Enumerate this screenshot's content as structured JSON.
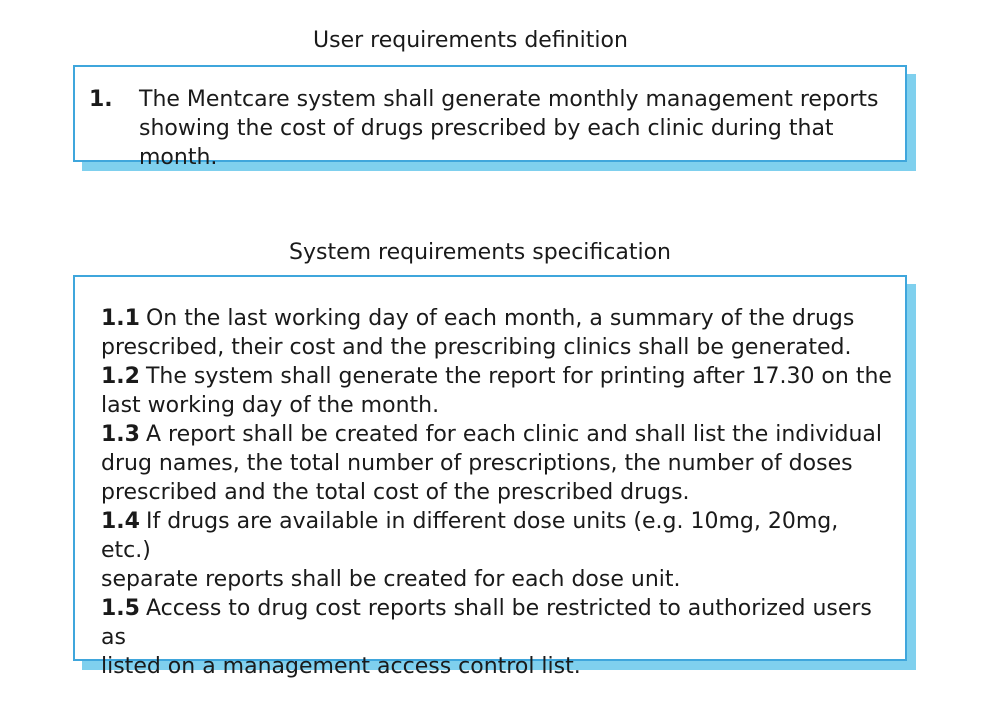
{
  "user_requirements": {
    "title": "User requirements definition",
    "items": [
      {
        "number": "1.",
        "text": "The Mentcare system shall generate monthly management reports\nshowing the cost of drugs prescribed by each clinic during that month."
      }
    ]
  },
  "system_requirements": {
    "title": "System requirements specification",
    "items": [
      {
        "number": "1.1",
        "text": "On the last working day of each month, a summary of the drugs\nprescribed, their cost and the prescribing clinics shall be generated."
      },
      {
        "number": "1.2",
        "text": "The system shall generate the report for printing after 17.30 on the\nlast working day of the month."
      },
      {
        "number": "1.3",
        "text": "A report shall be created for each clinic and shall list the individual\ndrug names, the total number of prescriptions, the number of doses\nprescribed and the total cost of the prescribed drugs."
      },
      {
        "number": "1.4",
        "text": "If drugs are available in different dose units (e.g. 10mg, 20mg, etc.)\nseparate reports shall be created for each dose unit."
      },
      {
        "number": "1.5",
        "text": "Access to drug cost reports shall be restricted to authorized users as\nlisted on a management access control list."
      }
    ]
  },
  "colors": {
    "box_border": "#3fa6dc",
    "box_shadow": "#7fd0ee",
    "text": "#1a1a1a"
  }
}
